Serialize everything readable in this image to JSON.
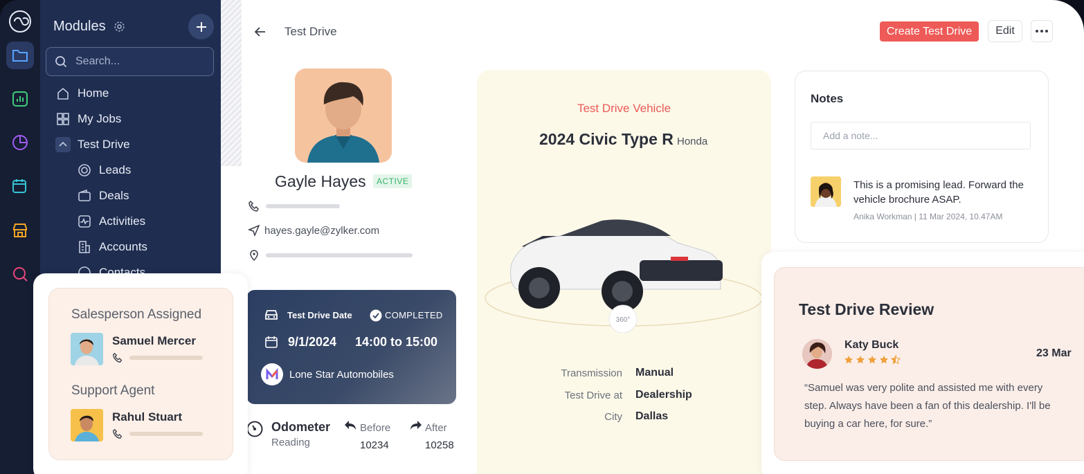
{
  "sidebar": {
    "title": "Modules",
    "search_placeholder": "Search...",
    "items": [
      {
        "label": "Home",
        "icon": "home-icon"
      },
      {
        "label": "My Jobs",
        "icon": "grid-icon"
      },
      {
        "label": "Test Drive",
        "icon": "chevron-up-icon"
      },
      {
        "label": "Leads",
        "icon": "target-icon"
      },
      {
        "label": "Deals",
        "icon": "wallet-icon"
      },
      {
        "label": "Activities",
        "icon": "activity-icon"
      },
      {
        "label": "Accounts",
        "icon": "building-icon"
      },
      {
        "label": "Contacts",
        "icon": "contact-icon"
      }
    ]
  },
  "header": {
    "breadcrumb": "Test Drive",
    "create_label": "Create Test Drive",
    "edit_label": "Edit"
  },
  "profile": {
    "name": "Gayle Hayes",
    "status": "ACTIVE",
    "email": "hayes.gayle@zylker.com"
  },
  "test_drive": {
    "date_label": "Test Drive Date",
    "status": "COMPLETED",
    "date": "9/1/2024",
    "time": "14:00 to 15:00",
    "dealer": "Lone Star Automobiles"
  },
  "odometer": {
    "title": "Odometer",
    "subtitle": "Reading",
    "before_label": "Before",
    "after_label": "After",
    "before": "10234",
    "after": "10258"
  },
  "vehicle": {
    "label": "Test Drive Vehicle",
    "model": "2024 Civic Type R",
    "brand": "Honda",
    "specs": [
      {
        "key": "Transmission",
        "value": "Manual"
      },
      {
        "key": "Test Drive at",
        "value": "Dealership"
      },
      {
        "key": "City",
        "value": "Dallas"
      }
    ]
  },
  "notes": {
    "title": "Notes",
    "placeholder": "Add a note...",
    "note_text": "This is a promising lead. Forward the vehicle brochure ASAP.",
    "note_meta": "Anika Workman | 11 Mar 2024, 10.47AM"
  },
  "review": {
    "title": "Test Drive Review",
    "reviewer": "Katy Buck",
    "rating": 4.5,
    "date": "23 Mar",
    "quote": "“Samuel was very polite and assisted me with every step. Always have been a fan of this dealership. I'll be buying a car here, for sure.”"
  },
  "assigned": {
    "salesperson_label": "Salesperson Assigned",
    "salesperson": "Samuel Mercer",
    "support_label": "Support Agent",
    "support": "Rahul Stuart"
  },
  "colors": {
    "accent": "#ee5a57",
    "sidebar": "#1f2d50",
    "active_badge": "#37b36b",
    "star": "#f0a03c"
  }
}
